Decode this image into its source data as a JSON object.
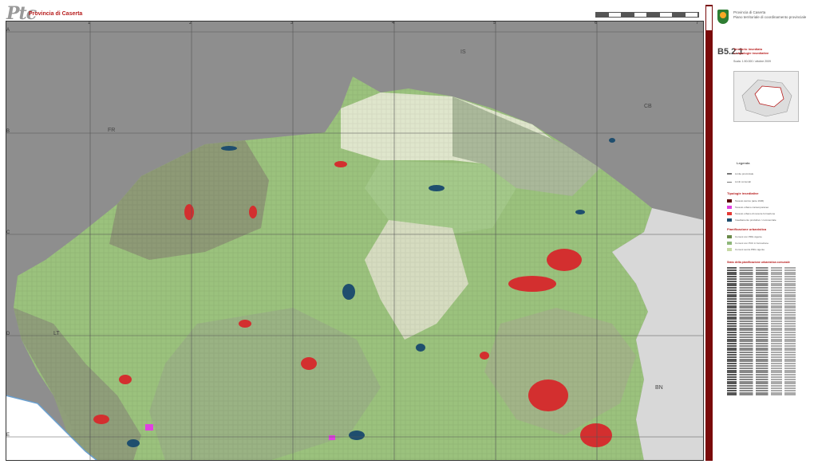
{
  "header": {
    "logo": "Ptc",
    "province": "Provincia di Caserta"
  },
  "panel": {
    "title_line1": "Provincia di Caserta",
    "title_line2": "Piano territoriale di coordinamento provinciale",
    "code": "B5.2.1",
    "section_line1": "Territorio insediato",
    "section_line2": "Le tipologie insediative",
    "scale_date": "Scala: 1:50.000 / ottobre 2009",
    "legend_title": "Legenda",
    "legend_limits": [
      "Limite provinciale",
      "Limiti comunali"
    ],
    "typology_title": "Tipologie insediative",
    "typology_items": [
      {
        "label": "Tessuto storico (ante 1936)",
        "color": "#5a0000"
      },
      {
        "label": "Tessuto urbano contemporaneo",
        "color": "#e040e0"
      },
      {
        "label": "Tessuto urbano di recente formazione",
        "color": "#e53935"
      },
      {
        "label": "Insediamento produttivo / commerciale",
        "color": "#1f4e6e"
      }
    ],
    "planning_title": "Pianificazione urbanistica",
    "planning_items": [
      {
        "label": "Comuni con PRG vigente",
        "color": "#6b8b4a"
      },
      {
        "label": "Comuni con PUC in formazione",
        "color": "#8fb77a"
      },
      {
        "label": "Comuni senza PRG vigente",
        "color": "#c6d9a4"
      }
    ],
    "table_title": "Stato della pianificazione urbanistica comunale"
  },
  "map": {
    "grid_labels": [
      "1",
      "2",
      "3",
      "4",
      "5",
      "6",
      "7",
      "A",
      "B",
      "C",
      "D",
      "E"
    ],
    "zone_labels": [
      "IS",
      "CB",
      "FR",
      "LT",
      "BN"
    ],
    "colors": {
      "outside": "#8e8e8e",
      "sea": "#ffffff",
      "urban_red": "#d32f2f",
      "urban_blue": "#1f4e6e",
      "historic_magenta": "#e040e0"
    }
  }
}
